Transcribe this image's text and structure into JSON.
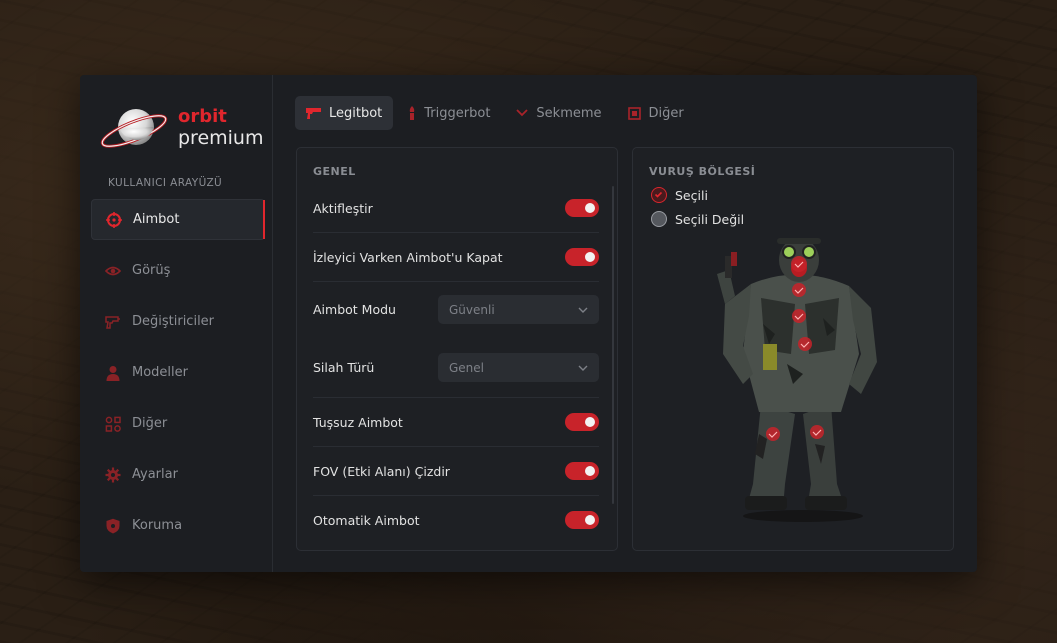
{
  "brand": {
    "name_top": "orbit",
    "name_bottom": "premium",
    "accent": "#e0262d"
  },
  "sidebar": {
    "section_label": "KULLANICI ARAYÜZÜ",
    "items": [
      {
        "label": "Aimbot",
        "icon": "crosshair-icon",
        "active": true
      },
      {
        "label": "Görüş",
        "icon": "eye-icon"
      },
      {
        "label": "Değiştiriciler",
        "icon": "gun-icon"
      },
      {
        "label": "Modeller",
        "icon": "user-icon"
      },
      {
        "label": "Diğer",
        "icon": "grid-icon"
      },
      {
        "label": "Ayarlar",
        "icon": "gear-icon"
      },
      {
        "label": "Koruma",
        "icon": "shield-icon"
      }
    ]
  },
  "tabs": [
    {
      "label": "Legitbot",
      "icon": "pistol-icon",
      "active": true
    },
    {
      "label": "Triggerbot",
      "icon": "bullet-icon"
    },
    {
      "label": "Sekmeme",
      "icon": "chevron-down-icon"
    },
    {
      "label": "Diğer",
      "icon": "box-icon"
    }
  ],
  "general": {
    "title": "GENEL",
    "rows": [
      {
        "label": "Aktifleştir",
        "type": "toggle",
        "value": true
      },
      {
        "label": "İzleyici Varken Aimbot'u Kapat",
        "type": "toggle",
        "value": true
      },
      {
        "label": "Aimbot Modu",
        "type": "select",
        "value": "Güvenli"
      },
      {
        "label": "Silah Türü",
        "type": "select",
        "value": "Genel"
      },
      {
        "label": "Tuşsuz Aimbot",
        "type": "toggle",
        "value": true
      },
      {
        "label": "FOV (Etki Alanı) Çizdir",
        "type": "toggle",
        "value": true
      },
      {
        "label": "Otomatik Aimbot",
        "type": "toggle",
        "value": true
      }
    ]
  },
  "hitbox": {
    "title": "VURUŞ BÖLGESİ",
    "legend": [
      {
        "label": "Seçili",
        "state": "selected"
      },
      {
        "label": "Seçili Değil",
        "state": "unselected"
      }
    ]
  }
}
